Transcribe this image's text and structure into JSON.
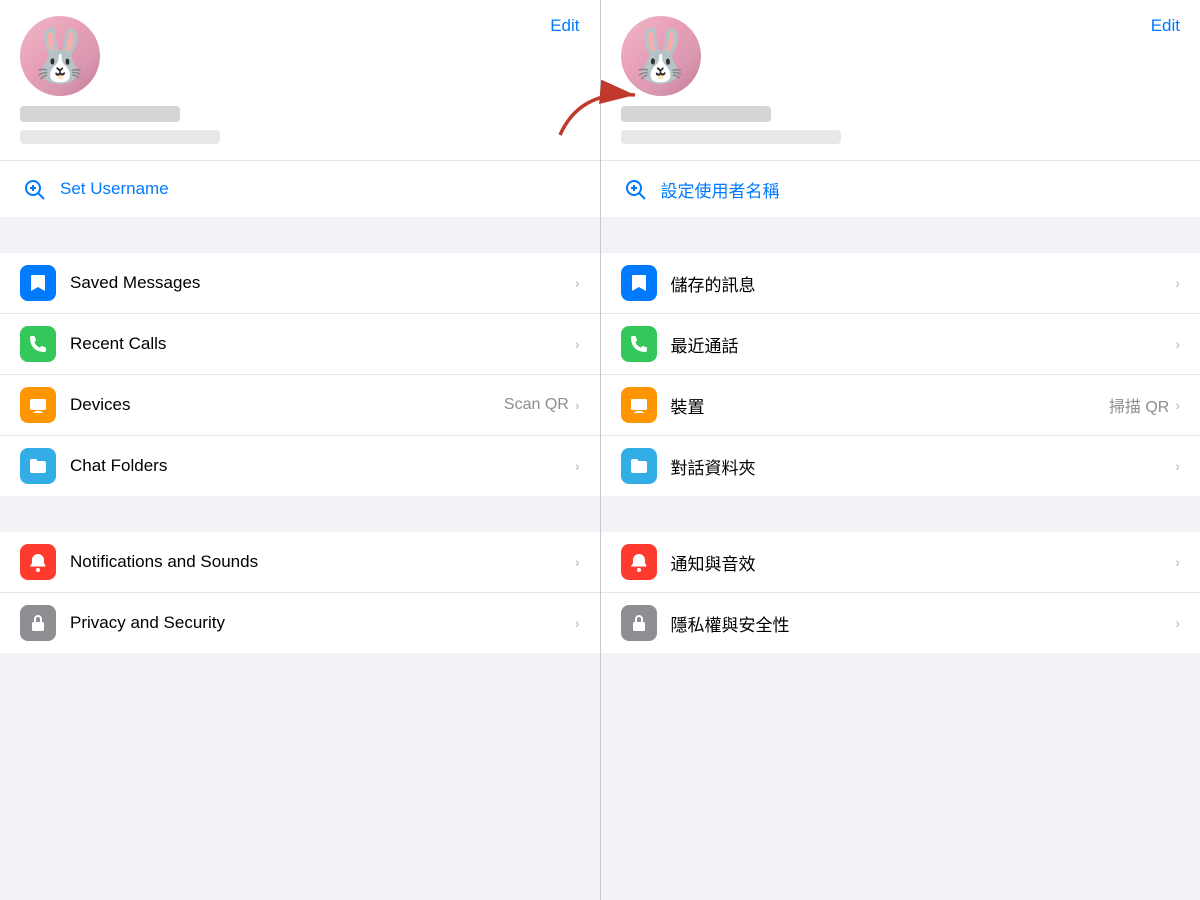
{
  "left": {
    "edit_label": "Edit",
    "username_label": "Set Username",
    "username_icon": "👤",
    "items_group1": [
      {
        "id": "saved-messages",
        "label": "Saved Messages",
        "icon_type": "blue",
        "icon": "bookmark",
        "secondary": "",
        "chevron": true
      },
      {
        "id": "recent-calls",
        "label": "Recent Calls",
        "icon_type": "green",
        "icon": "phone",
        "secondary": "",
        "chevron": true
      },
      {
        "id": "devices",
        "label": "Devices",
        "icon_type": "orange",
        "icon": "laptop",
        "secondary": "Scan QR",
        "chevron": true
      },
      {
        "id": "chat-folders",
        "label": "Chat Folders",
        "icon_type": "cyan",
        "icon": "folder",
        "secondary": "",
        "chevron": true
      }
    ],
    "items_group2": [
      {
        "id": "notifications",
        "label": "Notifications and Sounds",
        "icon_type": "red",
        "icon": "bell",
        "secondary": "",
        "chevron": true
      },
      {
        "id": "privacy",
        "label": "Privacy and Security",
        "icon_type": "gray",
        "icon": "lock",
        "secondary": "",
        "chevron": true
      }
    ]
  },
  "right": {
    "edit_label": "Edit",
    "username_label": "設定使用者名稱",
    "username_icon": "👤",
    "items_group1": [
      {
        "id": "saved-messages-zh",
        "label": "儲存的訊息",
        "icon_type": "blue",
        "icon": "bookmark",
        "secondary": "",
        "chevron": true
      },
      {
        "id": "recent-calls-zh",
        "label": "最近通話",
        "icon_type": "green",
        "icon": "phone",
        "secondary": "",
        "chevron": true
      },
      {
        "id": "devices-zh",
        "label": "裝置",
        "icon_type": "orange",
        "icon": "laptop",
        "secondary": "掃描 QR",
        "chevron": true
      },
      {
        "id": "chat-folders-zh",
        "label": "對話資料夾",
        "icon_type": "cyan",
        "icon": "folder",
        "secondary": "",
        "chevron": true
      }
    ],
    "items_group2": [
      {
        "id": "notifications-zh",
        "label": "通知與音效",
        "icon_type": "red",
        "icon": "bell",
        "secondary": "",
        "chevron": true
      },
      {
        "id": "privacy-zh",
        "label": "隱私權與安全性",
        "icon_type": "gray",
        "icon": "lock",
        "secondary": "",
        "chevron": true
      }
    ]
  },
  "colors": {
    "blue": "#007aff",
    "green": "#34c759",
    "orange": "#ff9500",
    "cyan": "#32ade6",
    "red": "#ff3b30",
    "gray": "#8e8e93"
  }
}
